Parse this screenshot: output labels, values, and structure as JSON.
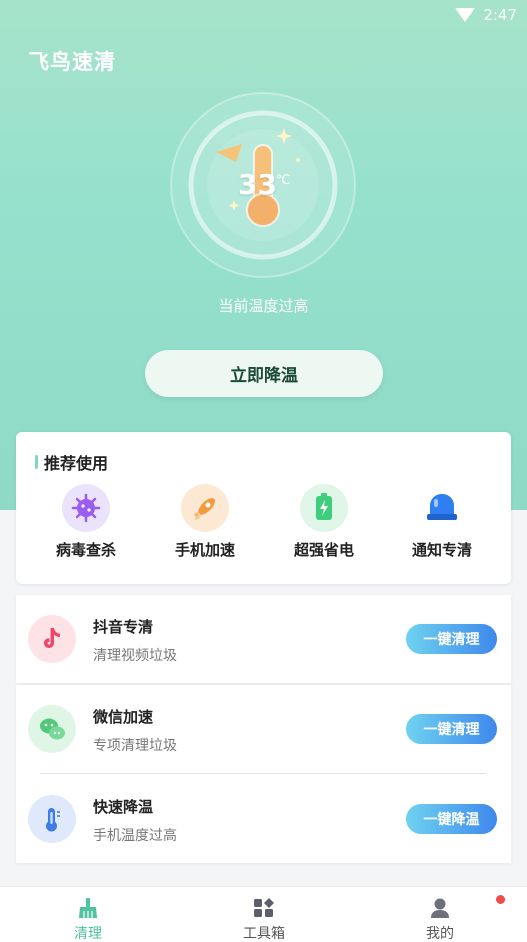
{
  "status": {
    "time": "2:47"
  },
  "app": {
    "title": "飞鸟速清"
  },
  "temperature": {
    "value": "33",
    "unit": "℃",
    "status_text": "当前温度过高"
  },
  "cool_button": {
    "label": "立即降温"
  },
  "recommend": {
    "title": "推荐使用",
    "items": [
      {
        "label": "病毒查杀",
        "icon": "virus-icon",
        "color": "#9b5cf0"
      },
      {
        "label": "手机加速",
        "icon": "rocket-icon",
        "color": "#f39a3c"
      },
      {
        "label": "超强省电",
        "icon": "battery-icon",
        "color": "#3fcf7c"
      },
      {
        "label": "通知专清",
        "icon": "bell-icon",
        "color": "#2f7ff0"
      }
    ]
  },
  "list": [
    {
      "title": "抖音专清",
      "subtitle": "清理视频垃圾",
      "button": "一键清理",
      "icon": "tiktok-icon"
    },
    {
      "title": "微信加速",
      "subtitle": "专项清理垃圾",
      "button": "一键清理",
      "icon": "wechat-icon"
    },
    {
      "title": "快速降温",
      "subtitle": "手机温度过高",
      "button": "一键降温",
      "icon": "thermometer-icon"
    }
  ],
  "tabs": [
    {
      "label": "清理",
      "icon": "broom-icon",
      "active": true
    },
    {
      "label": "工具箱",
      "icon": "toolbox-icon",
      "active": false
    },
    {
      "label": "我的",
      "icon": "user-icon",
      "active": false
    }
  ],
  "colors": {
    "accent": "#4fc3a1",
    "hero": "#95e1cc",
    "button_start": "#6fd2f0",
    "button_end": "#3e88ec"
  }
}
